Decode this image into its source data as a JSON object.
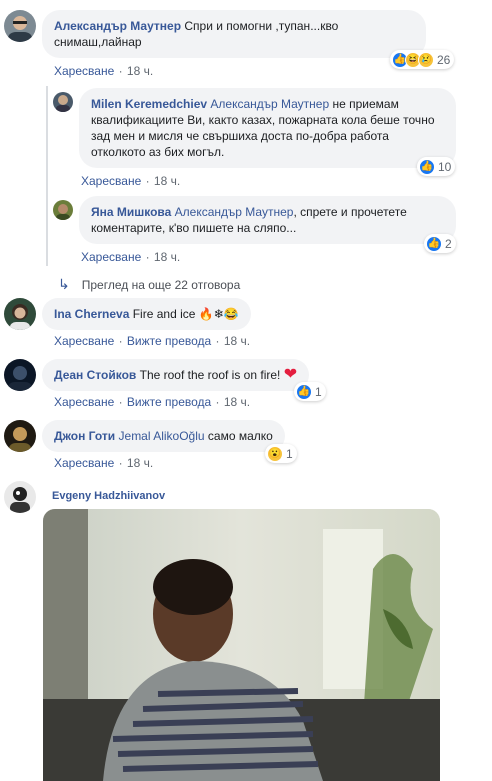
{
  "comments": [
    {
      "author": "Александър Маутнер",
      "text": "Спри и помогни ,тупан...кво снимаш,лайнар",
      "like": "Харесване",
      "time": "18 ч.",
      "reactions": [
        "like-icon",
        "haha-icon",
        "sad-icon"
      ],
      "reaction_count": "26"
    },
    {
      "author": "Milen Keremedchiev",
      "mention": "Александър Маутнер",
      "text": "не приемам квалификациите Ви, както казах, пожарната кола беше точно зад мен и мисля че свършиха доста по-добра работа отколкото аз бих могъл.",
      "like": "Харесване",
      "time": "18 ч.",
      "reactions": [
        "like-icon"
      ],
      "reaction_count": "10"
    },
    {
      "author": "Яна Мишкова",
      "mention": "Александър Маутнер",
      "text": ", спрете и прочетете коментарите, к'во пишете на сляпо...",
      "like": "Харесване",
      "time": "18 ч.",
      "reactions": [
        "like-icon"
      ],
      "reaction_count": "2"
    },
    {
      "author": "Ina Cherneva",
      "text": "Fire and ice",
      "emoji": "🔥❄😂",
      "like": "Харесване",
      "translate": "Вижте превода",
      "time": "18 ч."
    },
    {
      "author": "Деан Стойков",
      "text": "The roof the roof is on fire!",
      "emoji": "❤",
      "like": "Харесване",
      "translate": "Вижте превода",
      "time": "18 ч.",
      "reactions": [
        "like-icon"
      ],
      "reaction_count": "1"
    },
    {
      "author": "Джон Готи",
      "mention": "Jemal AlikoOğlu",
      "text": "само малко",
      "like": "Харесване",
      "time": "18 ч.",
      "reactions": [
        "wow-icon"
      ],
      "reaction_count": "1"
    }
  ],
  "more_replies": "Преглед на още 22 отговора",
  "gif_comment": {
    "author": "Evgeny Hadzhiivanov"
  },
  "colors": {
    "link": "#385898",
    "bubble": "#f2f3f5",
    "meta": "#606770",
    "like_blue": "#1877f2"
  }
}
